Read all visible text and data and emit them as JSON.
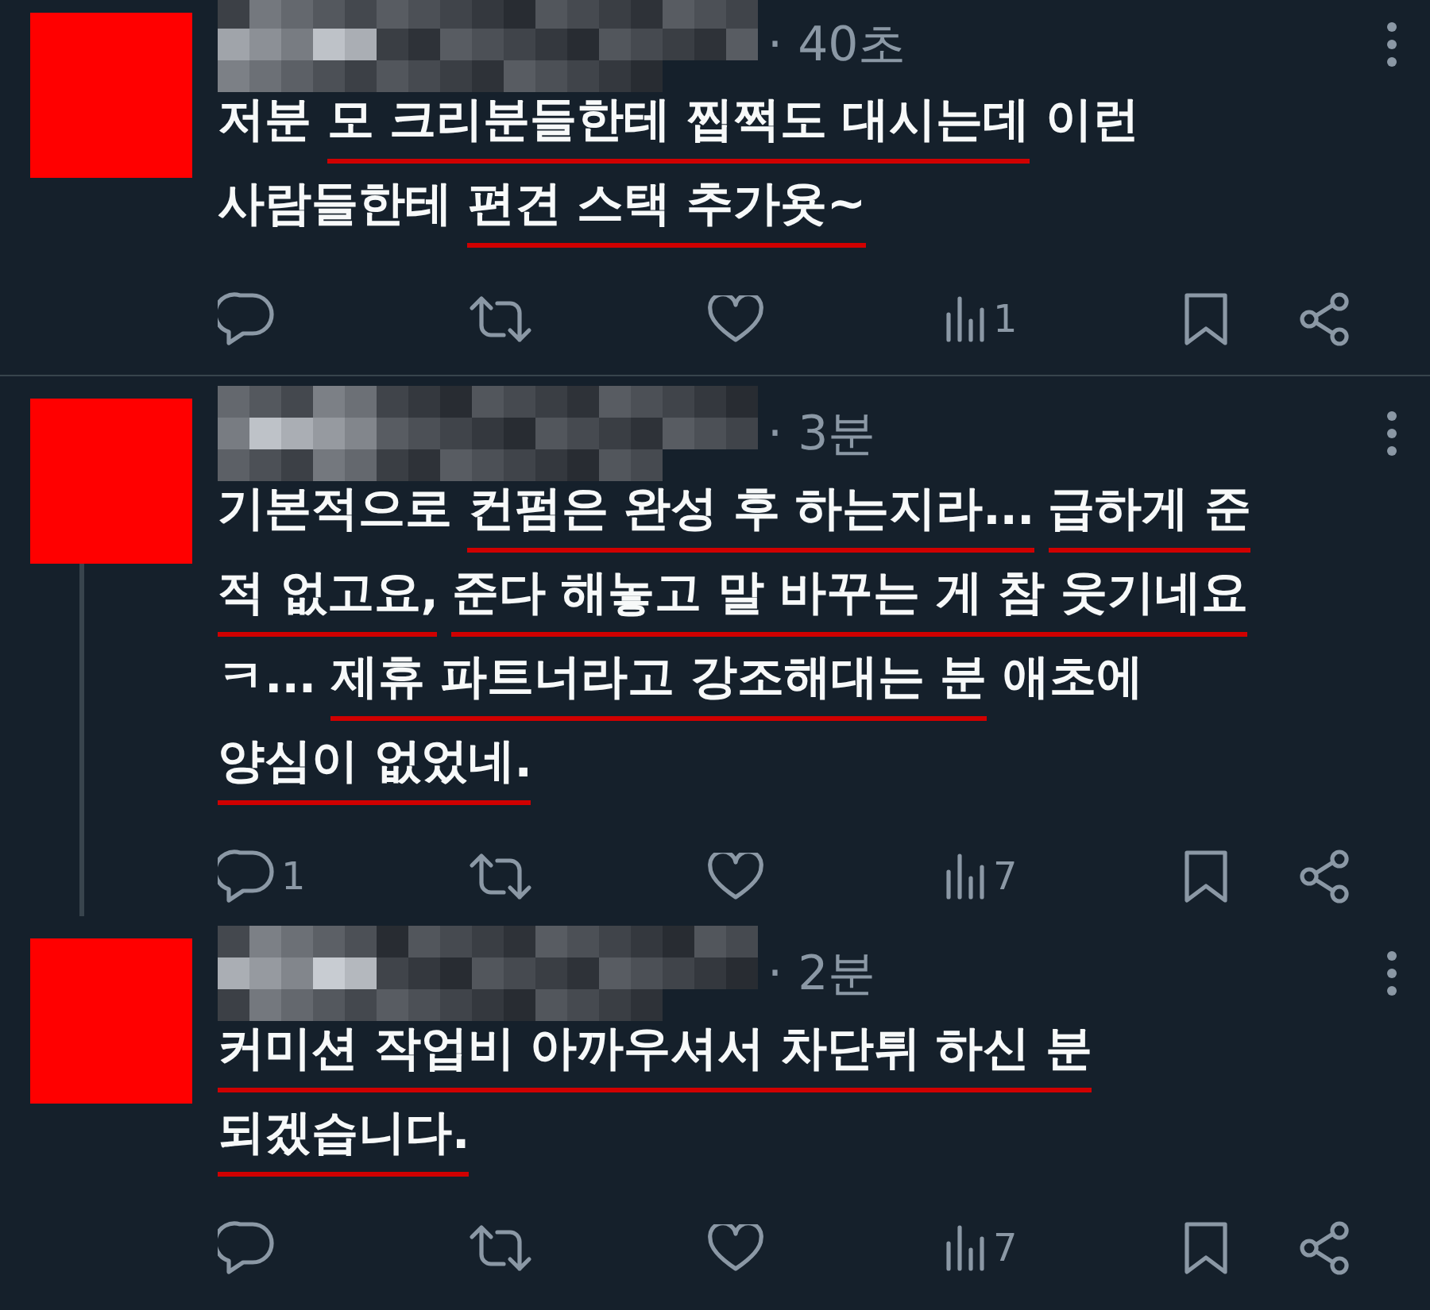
{
  "tweets": [
    {
      "time": "· 40초",
      "thread_continues": false,
      "divider_below": true,
      "lines": [
        [
          {
            "text": "저분 ",
            "underlined": false
          },
          {
            "text": "모 크리분들한테 찝쩍도 대시는데",
            "underlined": true
          },
          {
            "text": " 이런",
            "underlined": false
          }
        ],
        [
          {
            "text": "사람들한테 ",
            "underlined": false
          },
          {
            "text": "편견 스택 추가욧~",
            "underlined": true
          }
        ]
      ],
      "views": "1"
    },
    {
      "time": "· 3분",
      "thread_continues": true,
      "divider_below": false,
      "lines": [
        [
          {
            "text": "기본적으로 ",
            "underlined": false
          },
          {
            "text": "컨펌은 완성 후 하는지라...",
            "underlined": true
          },
          {
            "text": "급하게 준",
            "underlined": true
          }
        ],
        [
          {
            "text": "적 없고요,",
            "underlined": true
          },
          {
            "text": "준다 해놓고 말 바꾸는 게 참 웃기네요",
            "underlined": true
          }
        ],
        [
          {
            "text": "ㅋ... ",
            "underlined": false
          },
          {
            "text": "제휴 파트너라고 강조해대는 분",
            "underlined": true
          },
          {
            "text": " 애초에",
            "underlined": false
          }
        ],
        [
          {
            "text": "양심이 없었네.",
            "underlined": true
          }
        ]
      ],
      "replies": "1",
      "views": "7"
    },
    {
      "time": "· 2분",
      "thread_continues": false,
      "divider_below": false,
      "lines": [
        [
          {
            "text": "커미션 작업비 아까우셔서 차단튀 하신 분",
            "underlined": true
          }
        ],
        [
          {
            "text": "되겠습니다.",
            "underlined": true
          }
        ]
      ],
      "views": "7"
    }
  ]
}
